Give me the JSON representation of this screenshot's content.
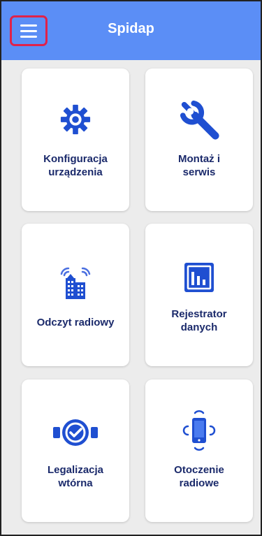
{
  "appbar": {
    "title": "Spidap",
    "menu_icon": "hamburger-menu-icon",
    "color": "#5b8ef6",
    "highlight_color": "#e0224a"
  },
  "accent_color": "#1f4fd1",
  "tiles": [
    {
      "line1": "Konfiguracja",
      "line2": "urządzenia",
      "icon": "gear-icon"
    },
    {
      "line1": "Montaż i",
      "line2": "serwis",
      "icon": "wrench-icon"
    },
    {
      "line1": "Odczyt radiowy",
      "line2": "",
      "icon": "radio-building-icon"
    },
    {
      "line1": "Rejestrator",
      "line2": "danych",
      "icon": "bar-chart-icon"
    },
    {
      "line1": "Legalizacja",
      "line2": "wtórna",
      "icon": "meter-check-icon"
    },
    {
      "line1": "Otoczenie",
      "line2": "radiowe",
      "icon": "phone-signal-icon"
    }
  ]
}
